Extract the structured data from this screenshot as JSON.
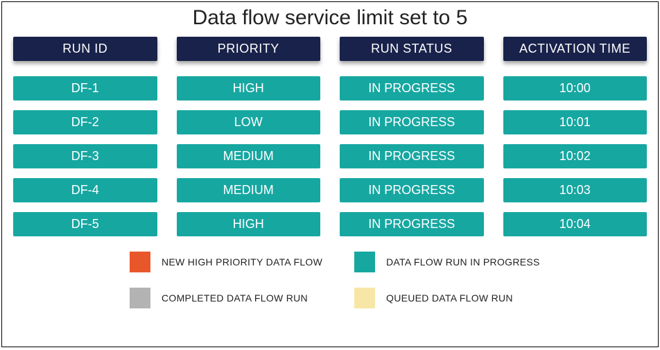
{
  "title": "Data flow service limit set to 5",
  "headers": {
    "run_id": "RUN ID",
    "priority": "PRIORITY",
    "run_status": "RUN STATUS",
    "activation_time": "ACTIVATION TIME"
  },
  "rows": [
    {
      "run_id": "DF-1",
      "priority": "HIGH",
      "run_status": "IN PROGRESS",
      "activation_time": "10:00"
    },
    {
      "run_id": "DF-2",
      "priority": "LOW",
      "run_status": "IN PROGRESS",
      "activation_time": "10:01"
    },
    {
      "run_id": "DF-3",
      "priority": "MEDIUM",
      "run_status": "IN PROGRESS",
      "activation_time": "10:02"
    },
    {
      "run_id": "DF-4",
      "priority": "MEDIUM",
      "run_status": "IN PROGRESS",
      "activation_time": "10:03"
    },
    {
      "run_id": "DF-5",
      "priority": "HIGH",
      "run_status": "IN PROGRESS",
      "activation_time": "10:04"
    }
  ],
  "legend": {
    "new_high": "NEW HIGH PRIORITY DATA FLOW",
    "in_progress": "DATA FLOW RUN IN PROGRESS",
    "completed": "COMPLETED DATA FLOW RUN",
    "queued": "QUEUED DATA FLOW RUN"
  },
  "colors": {
    "new_high": "#e8572a",
    "in_progress": "#17a7a1",
    "completed": "#b3b3b3",
    "queued": "#f7e7a7"
  }
}
